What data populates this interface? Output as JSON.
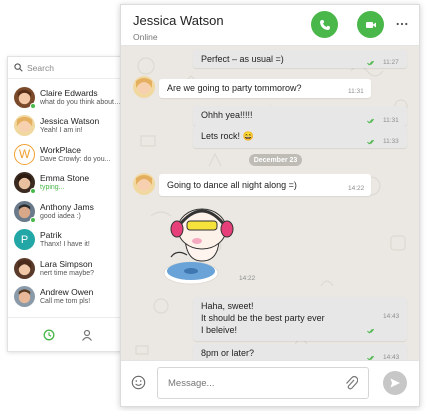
{
  "contacts_panel": {
    "search_placeholder": "Search",
    "contacts": [
      {
        "name": "Claire Edwards",
        "message": "what do you think about…"
      },
      {
        "name": "Jessica Watson",
        "message": "Yeah! I am in!"
      },
      {
        "name": "WorkPlace",
        "message": "Dave Crowly: do you..."
      },
      {
        "name": "Emma Stone",
        "message": "typing..."
      },
      {
        "name": "Anthony Jams",
        "message": "good iadea :)"
      },
      {
        "name": "Patrik",
        "message": "Thanx! I have it!"
      },
      {
        "name": "Lara Simpson",
        "message": "nert time maybe?"
      },
      {
        "name": "Andrew Owen",
        "message": "Call me tom pls!"
      }
    ],
    "workplace_initial": "W",
    "patrik_initial": "P",
    "tabs": [
      "recent-icon",
      "contacts-icon"
    ]
  },
  "chat": {
    "contact_name": "Jessica Watson",
    "status": "Online",
    "actions": [
      "phone-icon",
      "video-icon",
      "more-icon"
    ],
    "date_divider": "December 23",
    "messages": [
      {
        "direction": "out",
        "text": "Perfect – as usual =)",
        "time": "11:27"
      },
      {
        "direction": "in",
        "text": "Are we going to party tommorow?",
        "time": "11:31"
      },
      {
        "direction": "out",
        "text": "Ohhh yea!!!!!",
        "time": "11:31"
      },
      {
        "direction": "out",
        "text": "Lets rock! 😄",
        "time": "11:33"
      },
      {
        "direction": "in",
        "text": "Going to dance all night along =)",
        "time": "14:22"
      },
      {
        "direction": "in",
        "type": "sticker",
        "time": "14:22"
      },
      {
        "direction": "out",
        "lines": [
          "Haha, sweet!",
          "It should be the best party ever",
          "I beleive!"
        ],
        "time": "14:43"
      },
      {
        "direction": "out",
        "text": "8pm or later?",
        "time": "14:43"
      }
    ],
    "composer_placeholder": "Message...",
    "colors": {
      "accent": "#49b749",
      "wallpaper": "#ebe8e3",
      "outgoing": "#e7e7e7",
      "incoming": "#ffffff",
      "check": "#49b749"
    }
  }
}
